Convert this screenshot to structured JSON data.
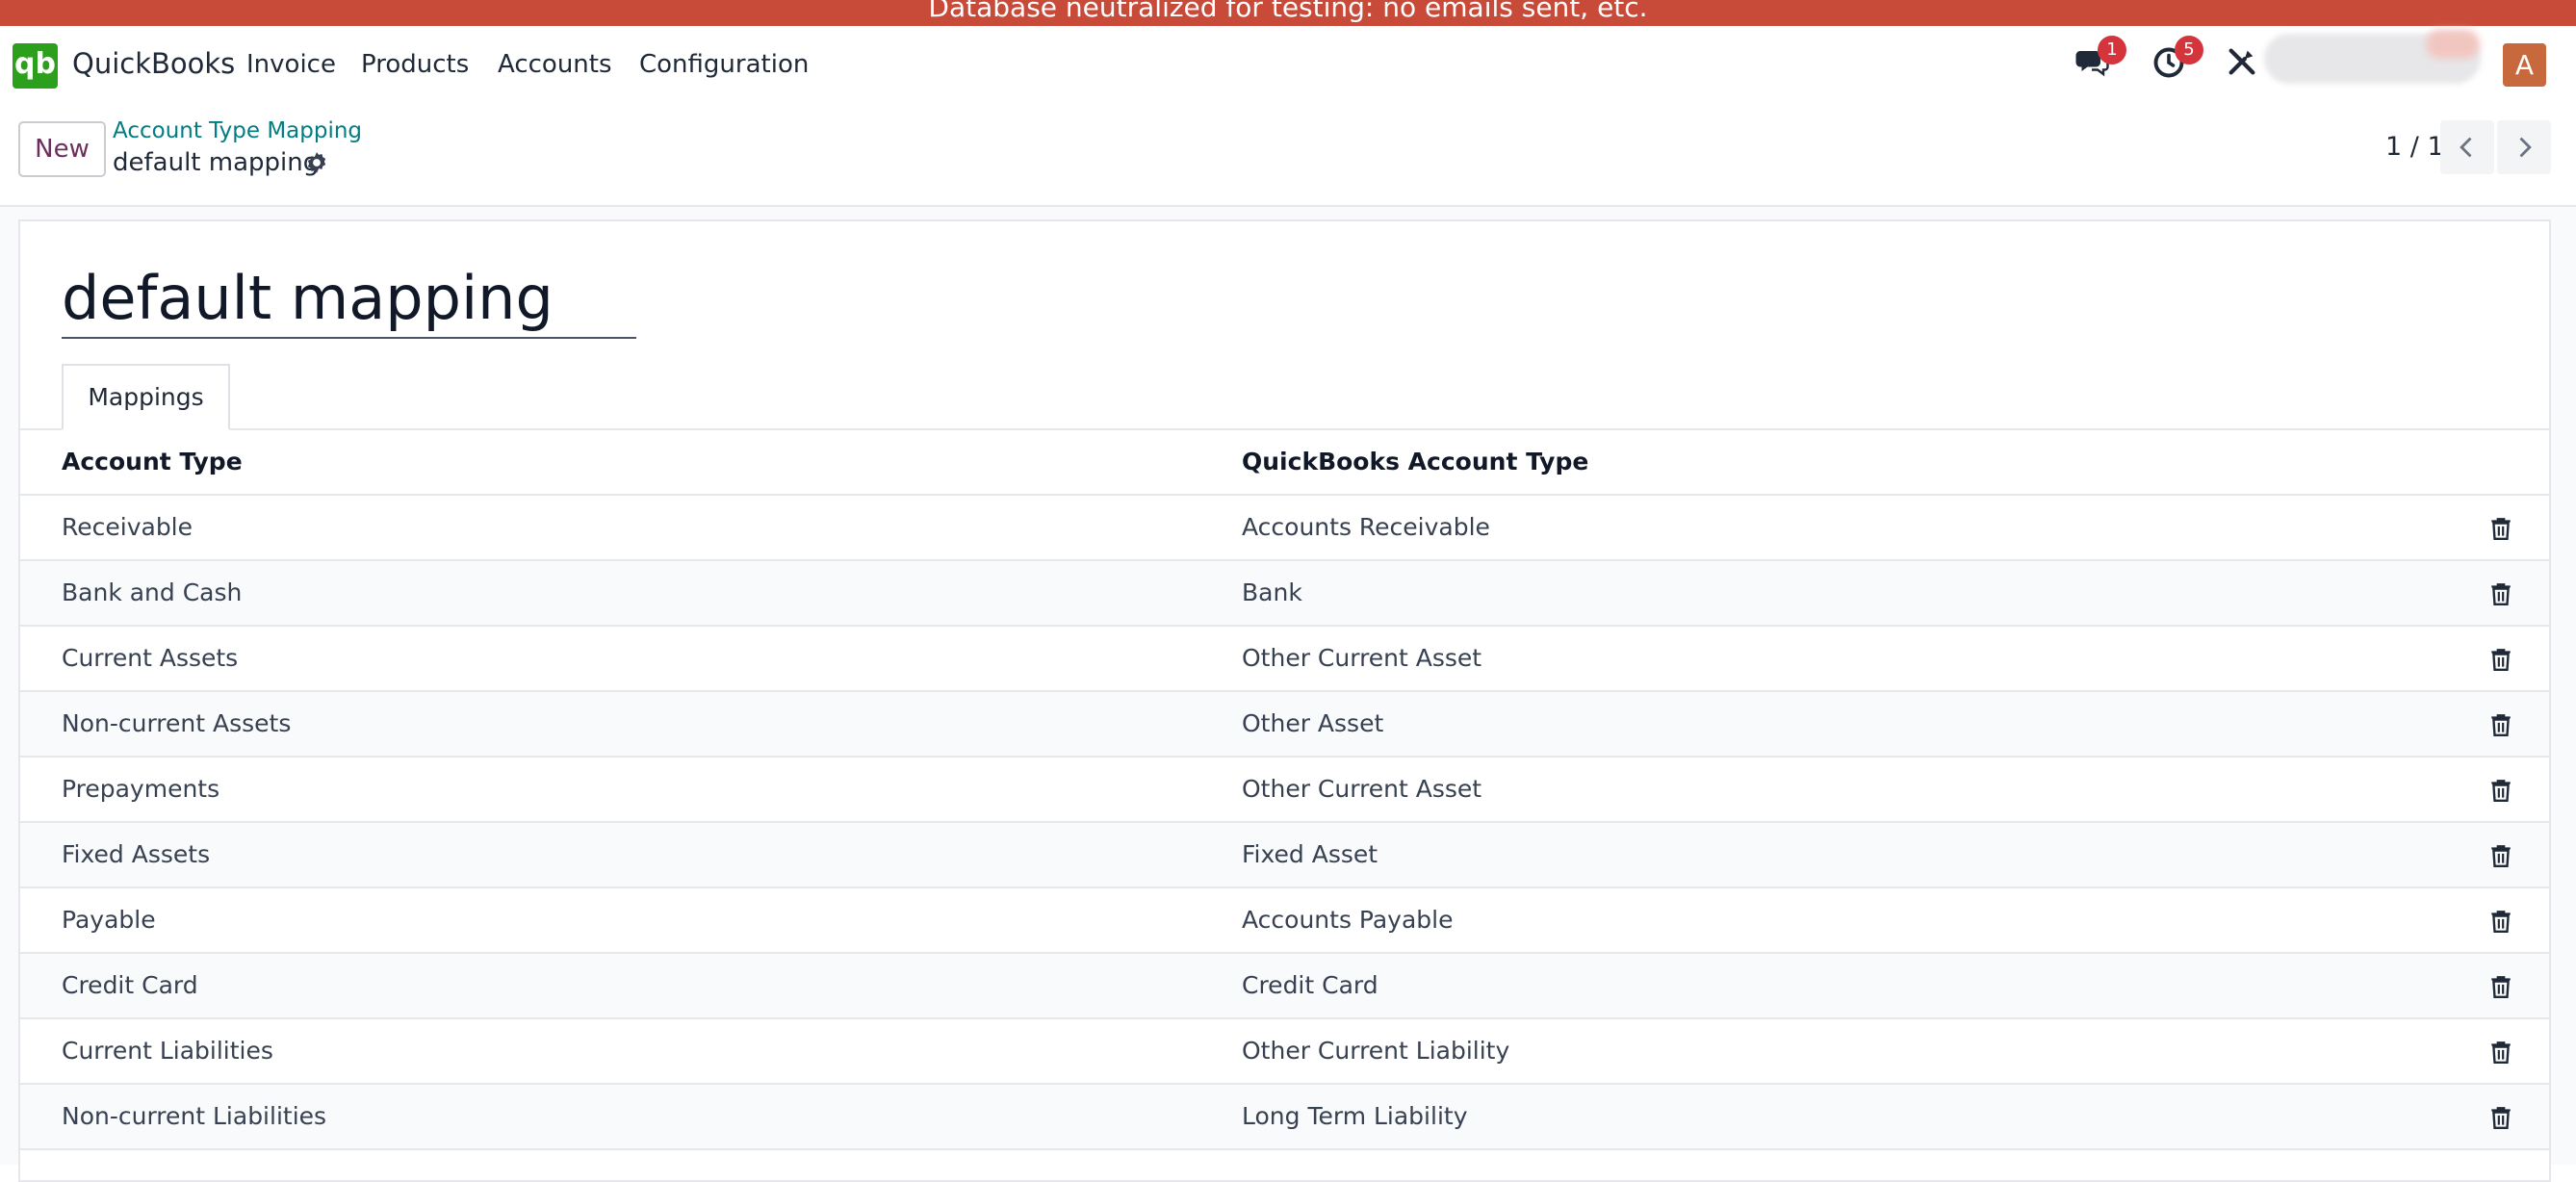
{
  "banner": {
    "text": "Database neutralized for testing: no emails sent, etc."
  },
  "navbar": {
    "app_logo": "qb",
    "app_name": "QuickBooks",
    "menu": [
      "Invoice",
      "Products",
      "Accounts",
      "Configuration"
    ],
    "messages_badge": "1",
    "activities_badge": "5",
    "user_initial": "A"
  },
  "control_panel": {
    "new_label": "New",
    "breadcrumb": "Account Type Mapping",
    "record_name": "default mapping",
    "pager": "1 / 1"
  },
  "form": {
    "name": "default mapping",
    "tab_label": "Mappings",
    "columns": [
      "Account Type",
      "QuickBooks Account Type"
    ],
    "rows": [
      {
        "account_type": "Receivable",
        "qb_type": "Accounts Receivable"
      },
      {
        "account_type": "Bank and Cash",
        "qb_type": "Bank"
      },
      {
        "account_type": "Current Assets",
        "qb_type": "Other Current Asset"
      },
      {
        "account_type": "Non-current Assets",
        "qb_type": "Other Asset"
      },
      {
        "account_type": "Prepayments",
        "qb_type": "Other Current Asset"
      },
      {
        "account_type": "Fixed Assets",
        "qb_type": "Fixed Asset"
      },
      {
        "account_type": "Payable",
        "qb_type": "Accounts Payable"
      },
      {
        "account_type": "Credit Card",
        "qb_type": "Credit Card"
      },
      {
        "account_type": "Current Liabilities",
        "qb_type": "Other Current Liability"
      },
      {
        "account_type": "Non-current Liabilities",
        "qb_type": "Long Term Liability"
      }
    ]
  },
  "colors": {
    "banner": "#c84b3a",
    "brand": "#2ca01c",
    "accent": "#017e84",
    "primary": "#6d2e5c",
    "badge": "#d4343c"
  },
  "icons": [
    "apps-logo",
    "chat-icon",
    "clock-icon",
    "tools-icon",
    "gear-icon",
    "chevron-left-icon",
    "chevron-right-icon",
    "trash-icon"
  ]
}
